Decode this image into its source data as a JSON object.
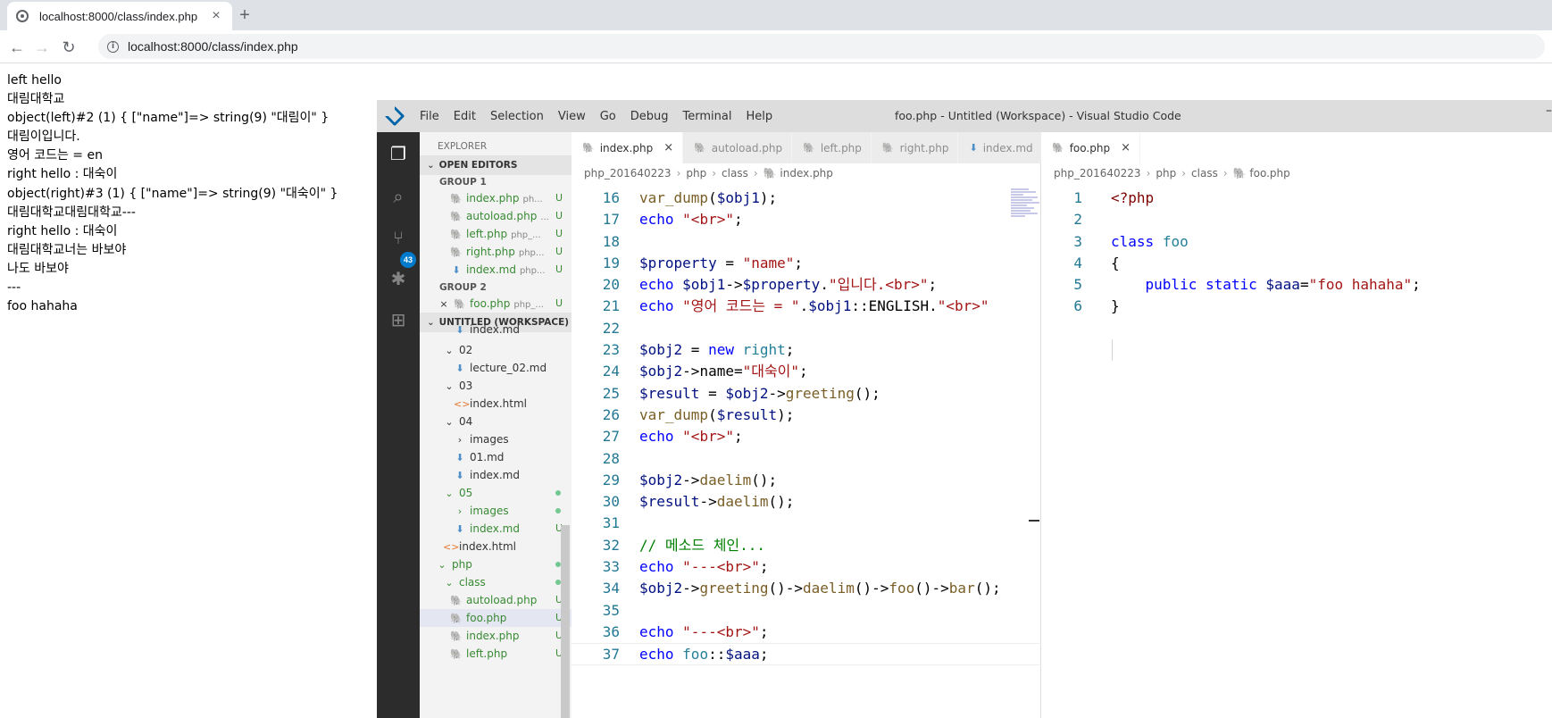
{
  "browser": {
    "tab_title": "localhost:8000/class/index.php",
    "tab_close": "×",
    "new_tab": "+",
    "back": "←",
    "forward": "→",
    "reload": "↻",
    "info": "i",
    "url": "localhost:8000/class/index.php"
  },
  "page_output": [
    "left hello",
    "대림대학교",
    "object(left)#2 (1) { [\"name\"]=> string(9) \"대림이\" }",
    "대림이입니다.",
    "영어 코드는 = en",
    "right hello : 대숙이",
    "object(right)#3 (1) { [\"name\"]=> string(9) \"대숙이\" }",
    "대림대학교대림대학교---",
    "right hello : 대숙이",
    "대림대학교너는 바보야",
    "나도 바보야",
    "---",
    "foo hahaha"
  ],
  "vscode": {
    "menu": [
      "File",
      "Edit",
      "Selection",
      "View",
      "Go",
      "Debug",
      "Terminal",
      "Help"
    ],
    "title": "foo.php - Untitled (Workspace) - Visual Studio Code",
    "title_dash": "–",
    "scm_badge": "43",
    "explorer": {
      "title": "EXPLORER",
      "open_editors": "OPEN EDITORS",
      "group1": "GROUP 1",
      "group2": "GROUP 2",
      "workspace": "UNTITLED (WORKSPACE)",
      "open_files_g1": [
        {
          "name": "index.php",
          "desc": "ph...",
          "status": "U"
        },
        {
          "name": "autoload.php",
          "desc": "...",
          "status": "U"
        },
        {
          "name": "left.php",
          "desc": "php_...",
          "status": "U"
        },
        {
          "name": "right.php",
          "desc": "php...",
          "status": "U"
        },
        {
          "name": "index.md",
          "desc": "php...",
          "status": "U"
        }
      ],
      "open_files_g2": [
        {
          "name": "foo.php",
          "desc": "php_...",
          "status": "U"
        }
      ],
      "tree": [
        "index.md",
        "02",
        "lecture_02.md",
        "03",
        "index.html",
        "04",
        "images",
        "01.md",
        "index.md",
        "05",
        "images",
        "index.md",
        "index.html",
        "php",
        "class",
        "autoload.php",
        "foo.php",
        "index.php",
        "left.php"
      ],
      "status_u": "U"
    },
    "editor1": {
      "tabs": [
        "index.php",
        "autoload.php",
        "left.php",
        "right.php",
        "index.md"
      ],
      "close": "×",
      "more": "···",
      "breadcrumb": [
        "php_201640223",
        "php",
        "class",
        "index.php"
      ],
      "lines": [
        "16",
        "17",
        "18",
        "19",
        "20",
        "21",
        "22",
        "23",
        "24",
        "25",
        "26",
        "27",
        "28",
        "29",
        "30",
        "31",
        "32",
        "33",
        "34",
        "35",
        "36",
        "37"
      ],
      "code": [
        "var_dump($obj1);",
        "echo \"<br>\";",
        "",
        "$property = \"name\";",
        "echo $obj1->$property.\"입니다.<br>\";",
        "echo \"영어 코드는 = \".$obj1::ENGLISH.\"<br>\"",
        "",
        "$obj2 = new right;",
        "$obj2->name=\"대숙이\";",
        "$result = $obj2->greeting();",
        "var_dump($result);",
        "echo \"<br>\";",
        "",
        "$obj2->daelim();",
        "$result->daelim();",
        "",
        "// 메소드 체인...",
        "echo \"---<br>\";",
        "$obj2->greeting()->daelim()->foo()->bar();",
        "",
        "echo \"---<br>\";",
        "echo foo::$aaa;"
      ]
    },
    "editor2": {
      "tab": "foo.php",
      "close": "×",
      "breadcrumb": [
        "php_201640223",
        "php",
        "class",
        "foo.php"
      ],
      "lines": [
        "1",
        "2",
        "3",
        "4",
        "5",
        "6"
      ],
      "code": [
        "<?php",
        "",
        "class foo",
        "{",
        "    public static $aaa=\"foo hahaha\";",
        "}"
      ]
    }
  }
}
